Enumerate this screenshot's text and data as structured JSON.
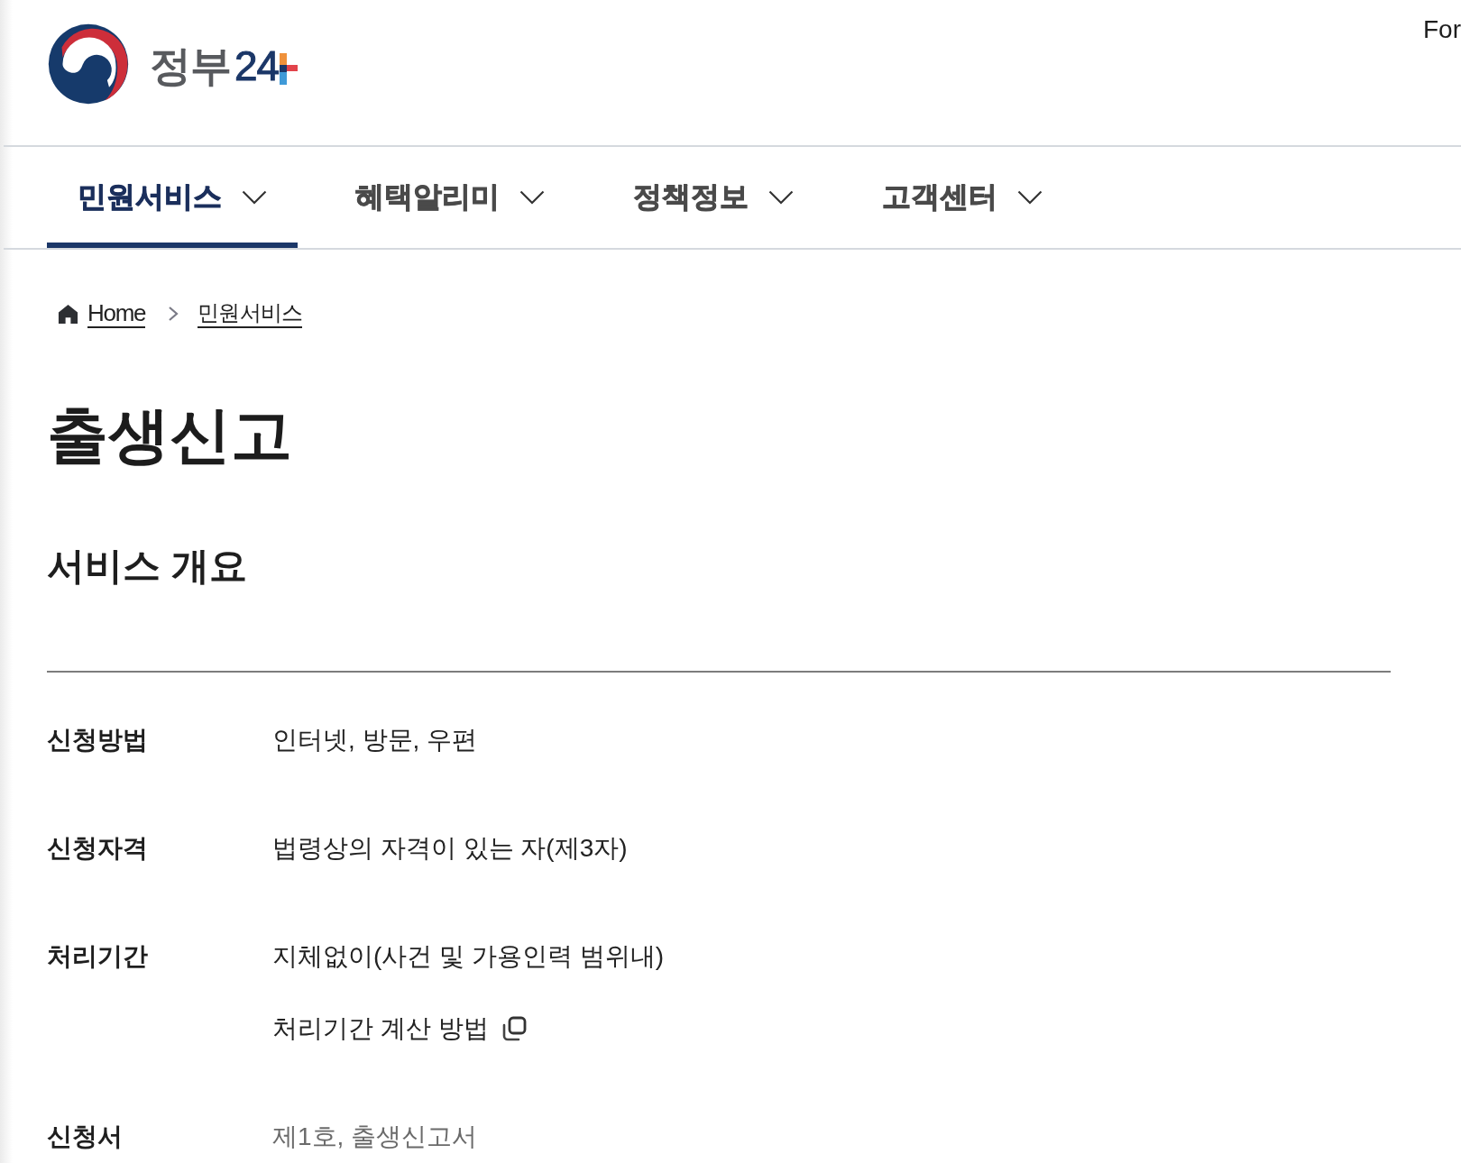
{
  "header": {
    "logo": {
      "text": "정부",
      "number": "24"
    },
    "top_link": "For"
  },
  "nav": {
    "tabs": [
      {
        "label": "민원서비스",
        "selected": true
      },
      {
        "label": "혜택알리미",
        "selected": false
      },
      {
        "label": "정책정보",
        "selected": false
      },
      {
        "label": "고객센터",
        "selected": false
      }
    ]
  },
  "breadcrumb": [
    {
      "kind": "home",
      "label": "Home"
    },
    {
      "kind": "page",
      "label": "민원서비스"
    }
  ],
  "page_title": "출생신고",
  "section_title": "서비스 개요",
  "details": [
    {
      "label": "신청방법",
      "values": [
        {
          "kind": "text",
          "text": "인터넷, 방문, 우편"
        }
      ]
    },
    {
      "label": "신청자격",
      "values": [
        {
          "kind": "text",
          "text": "법령상의 자격이 있는 자(제3자)"
        }
      ]
    },
    {
      "label": "처리기간",
      "values": [
        {
          "kind": "text",
          "text": "지체없이(사건 및 가용인력 범위내)"
        },
        {
          "kind": "link",
          "text": "처리기간 계산 방법"
        }
      ]
    },
    {
      "label": "신청서",
      "values": [
        {
          "kind": "muted",
          "text": "제1호, 출생신고서"
        }
      ]
    }
  ]
}
